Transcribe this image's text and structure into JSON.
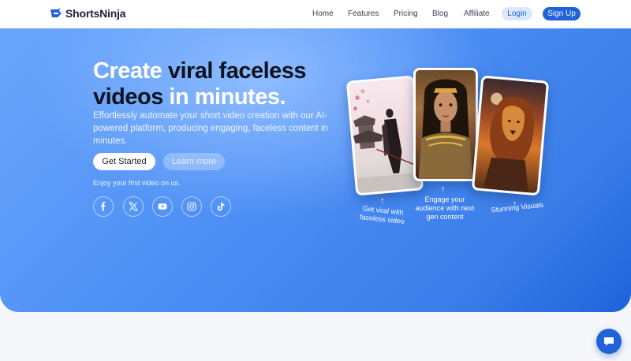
{
  "brand": {
    "name": "ShortsNinja",
    "accent": "#1f62d9"
  },
  "nav": {
    "links": [
      "Home",
      "Features",
      "Pricing",
      "Blog",
      "Affiliate"
    ],
    "login_label": "Login",
    "signup_label": "Sign Up"
  },
  "hero": {
    "headline_part1": "Create ",
    "headline_bold1": "viral faceless",
    "headline_bold2": "videos",
    "headline_part2": " in minutes.",
    "subtitle": "Effortlessly automate your short video creation with our AI-powered platform, producing engaging, faceless content in minutes.",
    "primary_cta": "Get Started",
    "secondary_cta": "Learn more",
    "trial_note": "Enjoy your first video on us.",
    "socials": [
      "facebook-icon",
      "x-icon",
      "youtube-icon",
      "instagram-icon",
      "tiktok-icon"
    ]
  },
  "showcase": {
    "cards": [
      "samurai-artwork",
      "warrior-woman-portrait",
      "lion-artwork"
    ],
    "captions": [
      "Get viral with faceless video",
      "Engage your audience with next gen content",
      "Stunning Visuals"
    ]
  }
}
